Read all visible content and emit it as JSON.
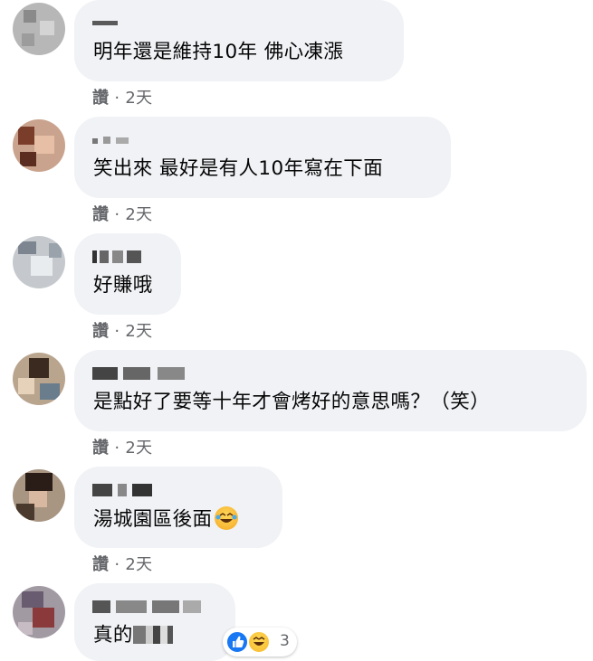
{
  "comments": [
    {
      "text": "明年還是維持10年 佛心凍漲",
      "action": "讚",
      "time": "2天"
    },
    {
      "text": "笑出來 最好是有人10年寫在下面",
      "action": "讚",
      "time": "2天"
    },
    {
      "text": "好賺哦",
      "action": "讚",
      "time": "2天"
    },
    {
      "text": "是點好了要等十年才會烤好的意思嗎？（笑）",
      "action": "讚",
      "time": "2天"
    },
    {
      "text": "湯城園區後面",
      "action": "讚",
      "time": "2天"
    },
    {
      "text": "真的",
      "action": "",
      "time": ""
    }
  ],
  "separator": " · ",
  "reactions": {
    "count": "3",
    "icons": [
      "like-icon",
      "haha-icon"
    ]
  },
  "colors": {
    "bubble": "#f0f2f5",
    "meta": "#65676b",
    "like_blue": "#1877f2",
    "haha_yellow": "#f7b928"
  }
}
